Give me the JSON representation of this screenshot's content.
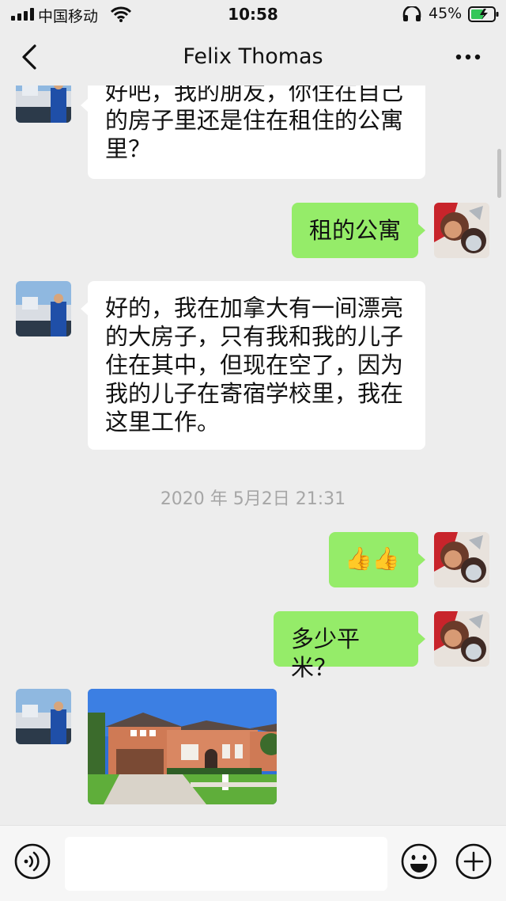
{
  "status_bar": {
    "carrier": "中国移动",
    "time": "10:58",
    "battery": "45%"
  },
  "header": {
    "title": "Felix Thomas"
  },
  "messages": [
    {
      "side": "left",
      "type": "text",
      "text": "好吧，我的朋友，你住在自己\n的房子里还是住在租住的公寓\n里？"
    },
    {
      "side": "right",
      "type": "text",
      "text": "租的公寓"
    },
    {
      "side": "left",
      "type": "text",
      "text": "好的，我在加拿大有一间漂亮\n的大房子，只有我和我的儿子\n住在其中，但现在空了，因为\n我的儿子在寄宿学校里，我在\n这里工作。"
    },
    {
      "type": "timestamp",
      "text": "2020 年 5月2日 21:31"
    },
    {
      "side": "right",
      "type": "text",
      "text": "👍👍"
    },
    {
      "side": "right",
      "type": "text",
      "text": "多少平米？"
    },
    {
      "side": "left",
      "type": "image",
      "image": "house-photo"
    }
  ],
  "input": {
    "value": "",
    "placeholder": ""
  },
  "colors": {
    "background": "#ededed",
    "bubble_sent": "#95ec69",
    "bubble_received": "#ffffff",
    "timestamp": "#a6a6a6"
  },
  "icons": [
    "back-icon",
    "more-icon",
    "voice-icon",
    "emoji-icon",
    "plus-icon",
    "wifi-icon",
    "headset-icon",
    "battery-icon",
    "signal-icon"
  ]
}
